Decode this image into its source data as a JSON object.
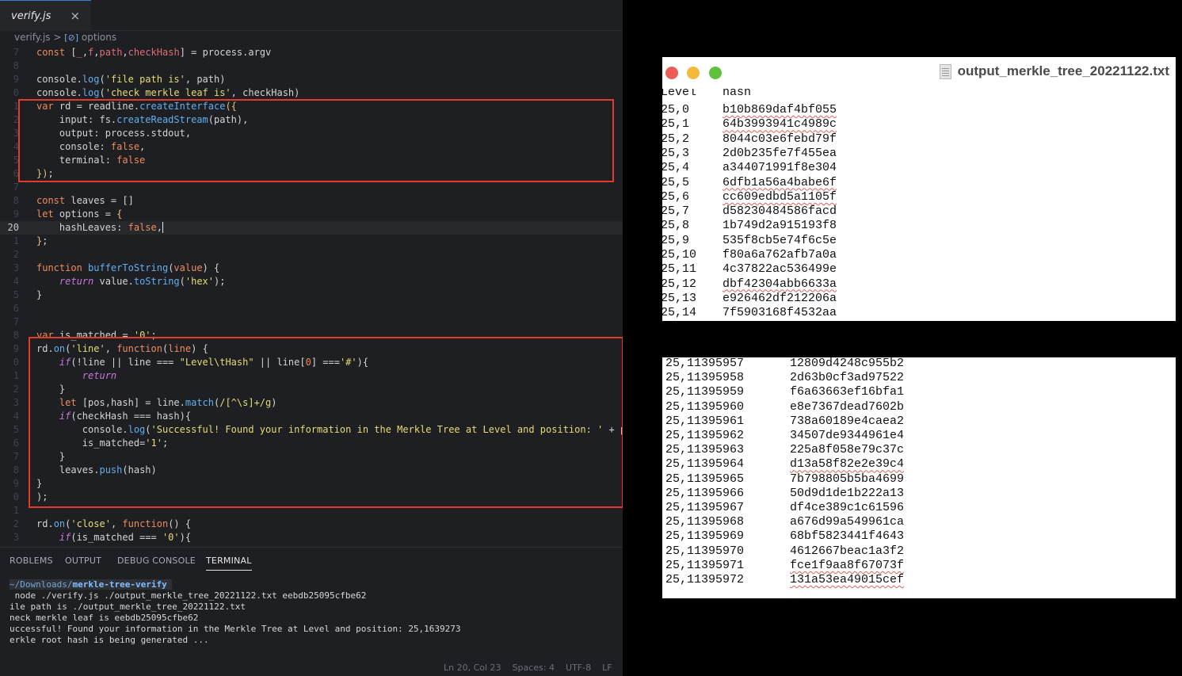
{
  "editor": {
    "tab_label": "verify.js",
    "tab_close": "×",
    "breadcrumb_file": "verify.js",
    "breadcrumb_sep": ">",
    "breadcrumb_symbol_icon": "[⊘]",
    "breadcrumb_symbol": "options",
    "line_numbers": [
      "7",
      "8",
      "9",
      "0",
      "1",
      "2",
      "3",
      "4",
      "5",
      "6",
      "7",
      "8",
      "9",
      "20",
      "1",
      "2",
      "3",
      "4",
      "5",
      "6",
      "7",
      "8",
      "9",
      "0",
      "1",
      "2",
      "3",
      "4",
      "5",
      "6",
      "7",
      "8",
      "9",
      "0",
      "1",
      "2",
      "3"
    ]
  },
  "panel": {
    "tabs": [
      "ROBLEMS",
      "OUTPUT",
      "DEBUG CONSOLE",
      "TERMINAL"
    ],
    "active_tab": "TERMINAL",
    "prompt_path": "~/Downloads/",
    "prompt_dir": "merkle-tree-verify",
    "terminal_lines": [
      " node ./verify.js ./output_merkle_tree_20221122.txt eebdb25095cfbe62",
      "ile path is ./output_merkle_tree_20221122.txt",
      "neck merkle leaf is eebdb25095cfbe62",
      "uccessful! Found your information in the Merkle Tree at Level and position: 25,1639273",
      "erkle root hash is being generated ..."
    ]
  },
  "status": {
    "position": "Ln 20, Col 23",
    "spaces": "Spaces: 4",
    "encoding": "UTF-8",
    "eol": "LF"
  },
  "window1": {
    "title": "output_merkle_tree_20221122.txt",
    "header_row": [
      "Level",
      "hash"
    ],
    "rows": [
      [
        "25,0",
        "b10b869daf4bf055"
      ],
      [
        "25,1",
        "64b3993941c4989c"
      ],
      [
        "25,2",
        "8044c03e6febd79f"
      ],
      [
        "25,3",
        "2d0b235fe7f455ea"
      ],
      [
        "25,4",
        "a344071991f8e304"
      ],
      [
        "25,5",
        "6dfb1a56a4babe6f"
      ],
      [
        "25,6",
        "cc609edbd5a1105f"
      ],
      [
        "25,7",
        "d58230484586facd"
      ],
      [
        "25,8",
        "1b749d2a915193f8"
      ],
      [
        "25,9",
        "535f8cb5e74f6c5e"
      ],
      [
        "25,10",
        "f80a6a762afb7a0a"
      ],
      [
        "25,11",
        "4c37822ac536499e"
      ],
      [
        "25,12",
        "dbf42304abb6633a"
      ],
      [
        "25,13",
        "e926462df212206a"
      ],
      [
        "25,14",
        "7f5903168f4532aa"
      ]
    ]
  },
  "window2": {
    "rows": [
      [
        "25,11395957",
        "12809d4248c955b2"
      ],
      [
        "25,11395958",
        "2d63b0cf3ad97522"
      ],
      [
        "25,11395959",
        "f6a63663ef16bfa1"
      ],
      [
        "25,11395960",
        "e8e7367dead7602b"
      ],
      [
        "25,11395961",
        "738a60189e4caea2"
      ],
      [
        "25,11395962",
        "34507de9344961e4"
      ],
      [
        "25,11395963",
        "225a8f058e79c37c"
      ],
      [
        "25,11395964",
        "d13a58f82e2e39c4"
      ],
      [
        "25,11395965",
        "7b798805b5ba4699"
      ],
      [
        "25,11395966",
        "50d9d1de1b222a13"
      ],
      [
        "25,11395967",
        "df4ce389c1c61596"
      ],
      [
        "25,11395968",
        "a676d99a549961ca"
      ],
      [
        "25,11395969",
        "68bf5823441f4643"
      ],
      [
        "25,11395970",
        "4612667beac1a3f2"
      ],
      [
        "25,11395971",
        "fce1f9aa8f67073f"
      ],
      [
        "25,11395972",
        "131a53ea49015cef"
      ]
    ]
  },
  "colors": {
    "highlight_box": "#e23b2e",
    "editor_bg": "#1e1f22",
    "traffic_close": "#ee5d55",
    "traffic_min": "#f5b93a",
    "traffic_max": "#5fc23d"
  }
}
